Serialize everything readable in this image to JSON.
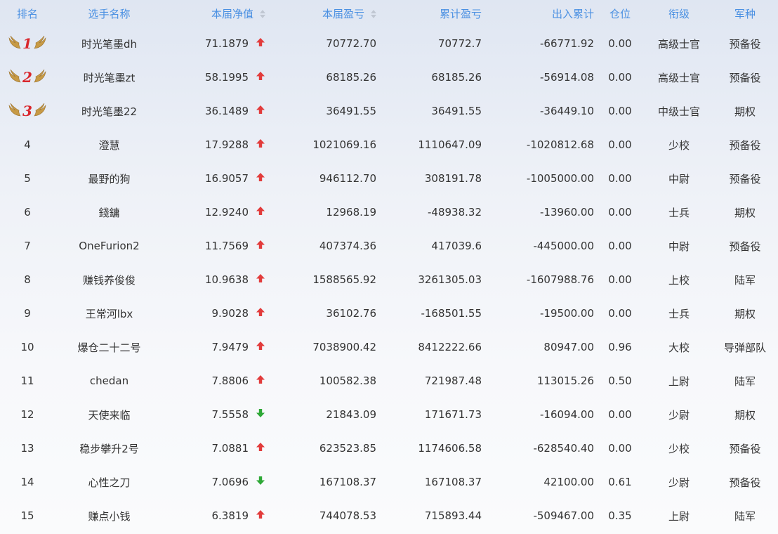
{
  "headers": {
    "rank": "排名",
    "name": "选手名称",
    "nav": "本届净值",
    "pnl": "本届盈亏",
    "cum": "累计盈亏",
    "io": "出入累计",
    "pos": "仓位",
    "title": "衔级",
    "arm": "军种"
  },
  "colors": {
    "header": "#4a90e2",
    "up": "#e23b3b",
    "down": "#2ea836",
    "medal": "#d9262c",
    "wing": "#c79a45"
  },
  "rows": [
    {
      "rank": "1",
      "medal": true,
      "name": "时光笔墨dh",
      "nav": "71.1879",
      "trend": "up",
      "pnl": "70772.70",
      "cum": "70772.7",
      "io": "-66771.92",
      "pos": "0.00",
      "title": "高级士官",
      "arm": "预备役"
    },
    {
      "rank": "2",
      "medal": true,
      "name": "时光笔墨zt",
      "nav": "58.1995",
      "trend": "up",
      "pnl": "68185.26",
      "cum": "68185.26",
      "io": "-56914.08",
      "pos": "0.00",
      "title": "高级士官",
      "arm": "预备役"
    },
    {
      "rank": "3",
      "medal": true,
      "name": "时光笔墨22",
      "nav": "36.1489",
      "trend": "up",
      "pnl": "36491.55",
      "cum": "36491.55",
      "io": "-36449.10",
      "pos": "0.00",
      "title": "中级士官",
      "arm": "期权"
    },
    {
      "rank": "4",
      "medal": false,
      "name": "澄慧",
      "nav": "17.9288",
      "trend": "up",
      "pnl": "1021069.16",
      "cum": "1110647.09",
      "io": "-1020812.68",
      "pos": "0.00",
      "title": "少校",
      "arm": "预备役"
    },
    {
      "rank": "5",
      "medal": false,
      "name": "最野的狗",
      "nav": "16.9057",
      "trend": "up",
      "pnl": "946112.70",
      "cum": "308191.78",
      "io": "-1005000.00",
      "pos": "0.00",
      "title": "中尉",
      "arm": "预备役"
    },
    {
      "rank": "6",
      "medal": false,
      "name": "錢鏞",
      "nav": "12.9240",
      "trend": "up",
      "pnl": "12968.19",
      "cum": "-48938.32",
      "io": "-13960.00",
      "pos": "0.00",
      "title": "士兵",
      "arm": "期权"
    },
    {
      "rank": "7",
      "medal": false,
      "name": "OneFurion2",
      "nav": "11.7569",
      "trend": "up",
      "pnl": "407374.36",
      "cum": "417039.6",
      "io": "-445000.00",
      "pos": "0.00",
      "title": "中尉",
      "arm": "预备役"
    },
    {
      "rank": "8",
      "medal": false,
      "name": "赚钱养俊俊",
      "nav": "10.9638",
      "trend": "up",
      "pnl": "1588565.92",
      "cum": "3261305.03",
      "io": "-1607988.76",
      "pos": "0.00",
      "title": "上校",
      "arm": "陆军"
    },
    {
      "rank": "9",
      "medal": false,
      "name": "王常河lbx",
      "nav": "9.9028",
      "trend": "up",
      "pnl": "36102.76",
      "cum": "-168501.55",
      "io": "-19500.00",
      "pos": "0.00",
      "title": "士兵",
      "arm": "期权"
    },
    {
      "rank": "10",
      "medal": false,
      "name": "爆仓二十二号",
      "nav": "7.9479",
      "trend": "up",
      "pnl": "7038900.42",
      "cum": "8412222.66",
      "io": "80947.00",
      "pos": "0.96",
      "title": "大校",
      "arm": "导弹部队"
    },
    {
      "rank": "11",
      "medal": false,
      "name": "chedan",
      "nav": "7.8806",
      "trend": "up",
      "pnl": "100582.38",
      "cum": "721987.48",
      "io": "113015.26",
      "pos": "0.50",
      "title": "上尉",
      "arm": "陆军"
    },
    {
      "rank": "12",
      "medal": false,
      "name": "天使来临",
      "nav": "7.5558",
      "trend": "down",
      "pnl": "21843.09",
      "cum": "171671.73",
      "io": "-16094.00",
      "pos": "0.00",
      "title": "少尉",
      "arm": "期权"
    },
    {
      "rank": "13",
      "medal": false,
      "name": "稳步攀升2号",
      "nav": "7.0881",
      "trend": "up",
      "pnl": "623523.85",
      "cum": "1174606.58",
      "io": "-628540.40",
      "pos": "0.00",
      "title": "少校",
      "arm": "预备役"
    },
    {
      "rank": "14",
      "medal": false,
      "name": "心性之刀",
      "nav": "7.0696",
      "trend": "down",
      "pnl": "167108.37",
      "cum": "167108.37",
      "io": "42100.00",
      "pos": "0.61",
      "title": "少尉",
      "arm": "预备役"
    },
    {
      "rank": "15",
      "medal": false,
      "name": "赚点小钱",
      "nav": "6.3819",
      "trend": "up",
      "pnl": "744078.53",
      "cum": "715893.44",
      "io": "-509467.00",
      "pos": "0.35",
      "title": "上尉",
      "arm": "陆军"
    }
  ]
}
